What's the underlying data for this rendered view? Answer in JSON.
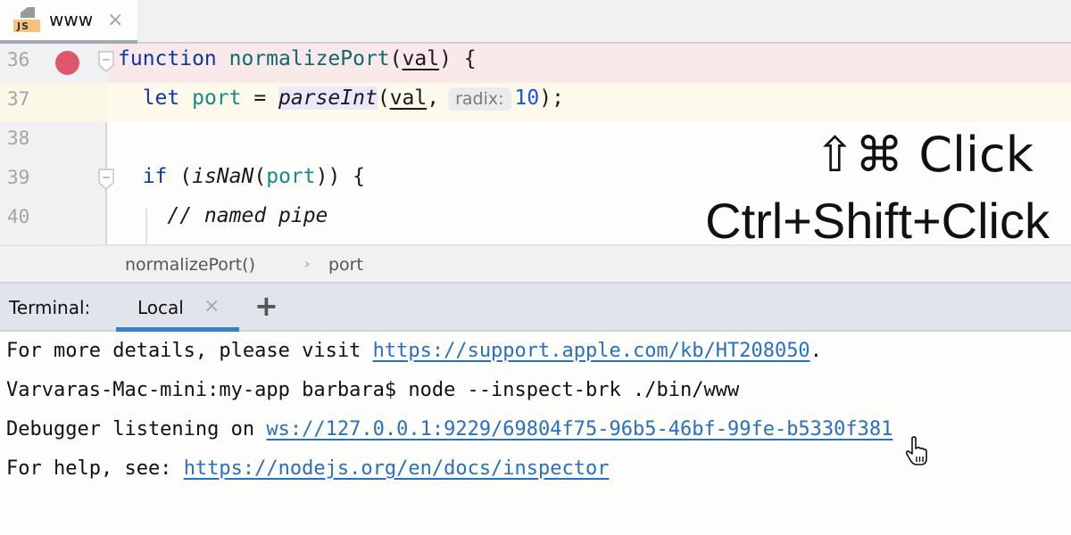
{
  "tab": {
    "icon": "js-file-icon",
    "icon_label": "JS",
    "label": "www",
    "close": "×"
  },
  "editor": {
    "lines": [
      {
        "number": "36",
        "breakpoint": true,
        "fold": true
      },
      {
        "number": "37",
        "current": true
      },
      {
        "number": "38"
      },
      {
        "number": "39",
        "fold": true
      },
      {
        "number": "40"
      }
    ],
    "code": {
      "l36_kw": "function",
      "l36_fn": "normalizePort",
      "l36_open": "(",
      "l36_param": "val",
      "l36_close": ") {",
      "l37_indent": "  ",
      "l37_kw": "let",
      "l37_var": "port",
      "l37_eq": " = ",
      "l37_fn": "parseInt",
      "l37_open": "(",
      "l37_param": "val",
      "l37_comma": ",",
      "l37_hint": "radix:",
      "l37_num": "10",
      "l37_close": ");",
      "l39_indent": "  ",
      "l39_kw": "if",
      "l39_open": " (",
      "l39_fn": "isNaN",
      "l39_paren": "(",
      "l39_var": "port",
      "l39_close": ")) {",
      "l40_comment": "    // named pipe"
    }
  },
  "overlay": {
    "mac_shortcut": "⇧⌘ Click",
    "win_shortcut": "Ctrl+Shift+Click"
  },
  "breadcrumb": {
    "items": [
      "normalizePort()",
      "port"
    ],
    "separator": "›"
  },
  "terminal": {
    "label": "Terminal:",
    "tab_label": "Local",
    "tab_close": "×",
    "add": "+",
    "lines": [
      {
        "prefix": "For more details, please visit ",
        "link": "https://support.apple.com/kb/HT208050",
        "suffix": "."
      },
      {
        "prefix": "Varvaras-Mac-mini:my-app barbara$ node --inspect-brk ./bin/www"
      },
      {
        "prefix": "Debugger listening on ",
        "link": "ws://127.0.0.1:9229/69804f75-96b5-46bf-99fe-b5330f381"
      },
      {
        "prefix": "For help, see: ",
        "link": "https://nodejs.org/en/docs/inspector"
      }
    ]
  },
  "colors": {
    "breakpoint": "#e0566a",
    "keyword": "#0d37a6",
    "link": "#2a6fc0",
    "tab_underline": "#3583c6"
  }
}
